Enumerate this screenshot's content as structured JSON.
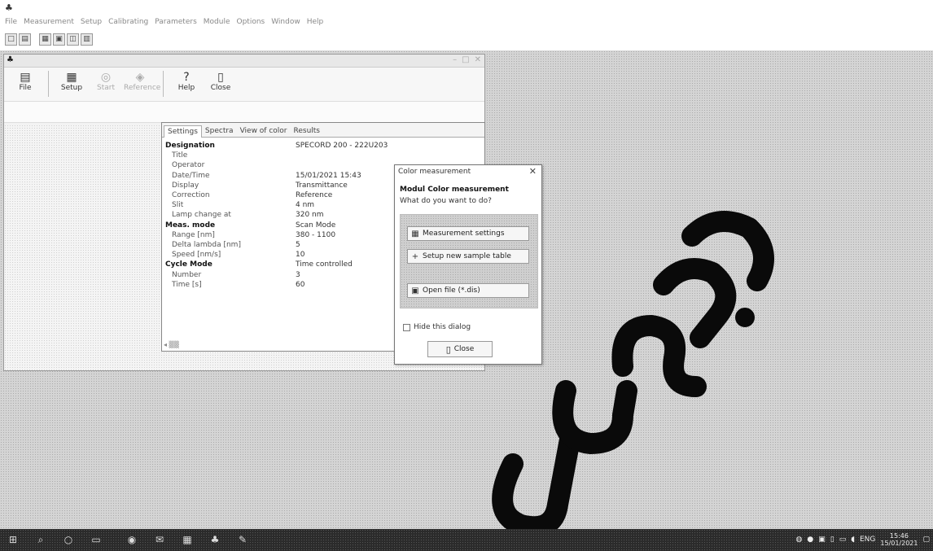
{
  "app": {
    "title": "",
    "menu": [
      "File",
      "Measurement",
      "Setup",
      "Calibrating",
      "Parameters",
      "Module",
      "Options",
      "Window",
      "Help"
    ]
  },
  "toolbar": {
    "file": "File",
    "setup": "Setup",
    "start": "Start",
    "reference": "Reference",
    "help": "Help",
    "close": "Close"
  },
  "tabs": [
    "Settings",
    "Spectra",
    "View of color",
    "Results"
  ],
  "settings": [
    {
      "label": "Designation",
      "value": "SPECORD 200 - 222U203",
      "kind": "head"
    },
    {
      "label": "Title",
      "value": "",
      "kind": "sub"
    },
    {
      "label": "Operator",
      "value": "",
      "kind": "sub"
    },
    {
      "label": "Date/Time",
      "value": "15/01/2021 15:43",
      "kind": "sub"
    },
    {
      "label": "Display",
      "value": "Transmittance",
      "kind": "sub"
    },
    {
      "label": "Correction",
      "value": "Reference",
      "kind": "sub"
    },
    {
      "label": "Slit",
      "value": "4 nm",
      "kind": "sub"
    },
    {
      "label": "Lamp change at",
      "value": "320 nm",
      "kind": "sub"
    },
    {
      "label": "Meas. mode",
      "value": "Scan Mode",
      "kind": "head"
    },
    {
      "label": "Range [nm]",
      "value": "380 - 1100",
      "kind": "sub"
    },
    {
      "label": "Delta lambda [nm]",
      "value": "5",
      "kind": "sub"
    },
    {
      "label": "Speed [nm/s]",
      "value": "10",
      "kind": "sub"
    },
    {
      "label": "Cycle Mode",
      "value": "Time controlled",
      "kind": "head"
    },
    {
      "label": "Number",
      "value": "3",
      "kind": "sub"
    },
    {
      "label": "Time [s]",
      "value": "60",
      "kind": "sub"
    }
  ],
  "dialog": {
    "title": "Color measurement",
    "heading": "Modul Color measurement",
    "question": "What do you want to do?",
    "btn_settings": "Measurement settings",
    "btn_setup": "Setup new sample table",
    "btn_open": "Open file (*.dis)",
    "hide_label": "Hide this dialog",
    "close_label": "Close"
  },
  "taskbar": {
    "time": "15:46",
    "date": "15/01/2021",
    "lang": "ENG"
  },
  "colors": {
    "desktop": "#d4d4d4",
    "taskbar": "#2b2b2b",
    "watermark": "#0a0a0a"
  }
}
